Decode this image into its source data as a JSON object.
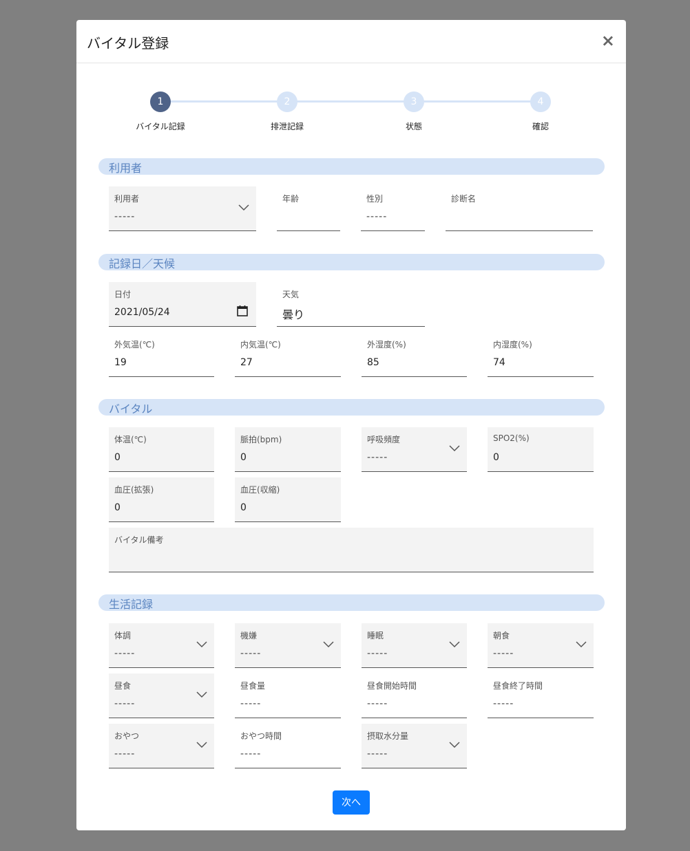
{
  "modal": {
    "title": "バイタル登録",
    "close": "×"
  },
  "steps": [
    {
      "num": "1",
      "label": "バイタル記録"
    },
    {
      "num": "2",
      "label": "排泄記録"
    },
    {
      "num": "3",
      "label": "状態"
    },
    {
      "num": "4",
      "label": "確認"
    }
  ],
  "sections": {
    "user": "利用者",
    "record": "記録日／天候",
    "vital": "バイタル",
    "life": "生活記録"
  },
  "user": {
    "user_label": "利用者",
    "user_value": "-----",
    "age_label": "年齢",
    "age_value": "",
    "gender_label": "性別",
    "gender_value": "-----",
    "diagnosis_label": "診断名",
    "diagnosis_value": ""
  },
  "record": {
    "date_label": "日付",
    "date_value": "2021/05/24",
    "weather_label": "天気",
    "weather_value": "曇り",
    "out_temp_label": "外気温(℃)",
    "out_temp_value": "19",
    "in_temp_label": "内気温(℃)",
    "in_temp_value": "27",
    "out_hum_label": "外湿度(%)",
    "out_hum_value": "85",
    "in_hum_label": "内湿度(%)",
    "in_hum_value": "74"
  },
  "vital": {
    "body_temp_label": "体温(℃)",
    "body_temp_value": "0",
    "pulse_label": "脈拍(bpm)",
    "pulse_value": "0",
    "resp_label": "呼吸頻度",
    "resp_value": "-----",
    "spo2_label": "SPO2(%)",
    "spo2_value": "0",
    "bp_dia_label": "血圧(拡張)",
    "bp_dia_value": "0",
    "bp_sys_label": "血圧(収縮)",
    "bp_sys_value": "0",
    "note_label": "バイタル備考",
    "note_value": ""
  },
  "life": {
    "condition_label": "体調",
    "condition_value": "-----",
    "mood_label": "機嫌",
    "mood_value": "-----",
    "sleep_label": "睡眠",
    "sleep_value": "-----",
    "breakfast_label": "朝食",
    "breakfast_value": "-----",
    "lunch_label": "昼食",
    "lunch_value": "-----",
    "lunch_amount_label": "昼食量",
    "lunch_amount_value": "-----",
    "lunch_start_label": "昼食開始時間",
    "lunch_start_value": "-----",
    "lunch_end_label": "昼食終了時間",
    "lunch_end_value": "-----",
    "snack_label": "おやつ",
    "snack_value": "-----",
    "snack_time_label": "おやつ時間",
    "snack_time_value": "-----",
    "water_label": "摂取水分量",
    "water_value": "-----"
  },
  "buttons": {
    "next": "次へ"
  }
}
